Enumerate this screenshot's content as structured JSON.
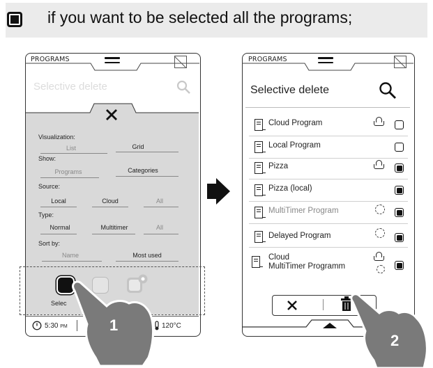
{
  "instruction": {
    "text": "if you want to be selected all the programs;"
  },
  "left_screen": {
    "header_label": "PROGRAMS",
    "header_subtitle_faded": "Selective delete",
    "filters": {
      "visualization": {
        "label": "Visualization:",
        "options": [
          "List",
          "Grid"
        ]
      },
      "show": {
        "label": "Show:",
        "options": [
          "Programs",
          "Categories"
        ]
      },
      "source": {
        "label": "Source:",
        "options": [
          "Local",
          "Cloud",
          "All"
        ]
      },
      "type": {
        "label": "Type:",
        "options": [
          "Normal",
          "Multitimer",
          "All"
        ]
      },
      "sort_by": {
        "label": "Sort by:",
        "options": [
          "Name",
          "Most used"
        ]
      }
    },
    "select_caption": "Selec",
    "status": {
      "time": "5:30",
      "time_suffix": "PM",
      "temperature": "120°C"
    },
    "step_number": "1"
  },
  "right_screen": {
    "header_label": "PROGRAMS",
    "title": "Selective delete",
    "programs": [
      {
        "name": "Cloud Program",
        "source_icon": "cloud-icon",
        "checked": false,
        "dim": false
      },
      {
        "name": "Local Program",
        "source_icon": "",
        "checked": false,
        "dim": false
      },
      {
        "name": "Pizza",
        "source_icon": "cloud-icon",
        "checked": true,
        "dim": false
      },
      {
        "name": "Pizza (local)",
        "source_icon": "",
        "checked": true,
        "dim": false
      },
      {
        "name": "MultiTimer Program",
        "source_icon": "multitimer-icon",
        "checked": true,
        "dim": true
      },
      {
        "name": "Delayed Program",
        "source_icon": "delayed-icon",
        "checked": true,
        "dim": false
      },
      {
        "name_line1": "Cloud",
        "name_line2": "MultiTimer Programm",
        "source_icon": "cloud-multitimer-icon",
        "checked": true,
        "dim": false
      }
    ],
    "step_number": "2"
  },
  "colors": {
    "banner_bg": "#ebebeb",
    "grey_panel": "#d9d9d9",
    "hand": "#7a7a7a",
    "ink": "#111111"
  }
}
